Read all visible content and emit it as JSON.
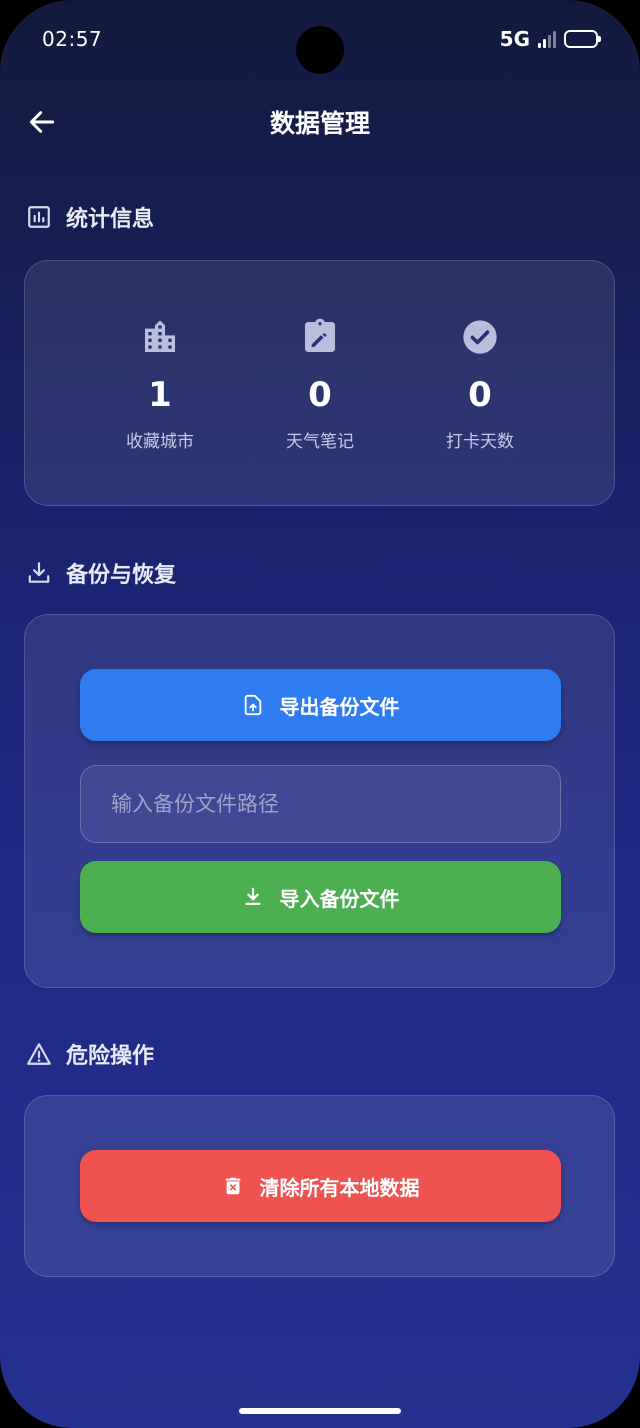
{
  "status_bar": {
    "time": "02:57",
    "network": "5G"
  },
  "header": {
    "title": "数据管理"
  },
  "stats_section": {
    "title": "统计信息",
    "items": [
      {
        "icon": "city-icon",
        "value": "1",
        "label": "收藏城市"
      },
      {
        "icon": "note-edit-icon",
        "value": "0",
        "label": "天气笔记"
      },
      {
        "icon": "check-circle-icon",
        "value": "0",
        "label": "打卡天数"
      }
    ]
  },
  "backup_section": {
    "title": "备份与恢复",
    "export_label": "导出备份文件",
    "path_placeholder": "输入备份文件路径",
    "path_value": "",
    "import_label": "导入备份文件"
  },
  "danger_section": {
    "title": "危险操作",
    "clear_label": "清除所有本地数据"
  },
  "colors": {
    "export_button": "#2f7cf0",
    "import_button": "#4caf50",
    "clear_button": "#ef5350"
  }
}
